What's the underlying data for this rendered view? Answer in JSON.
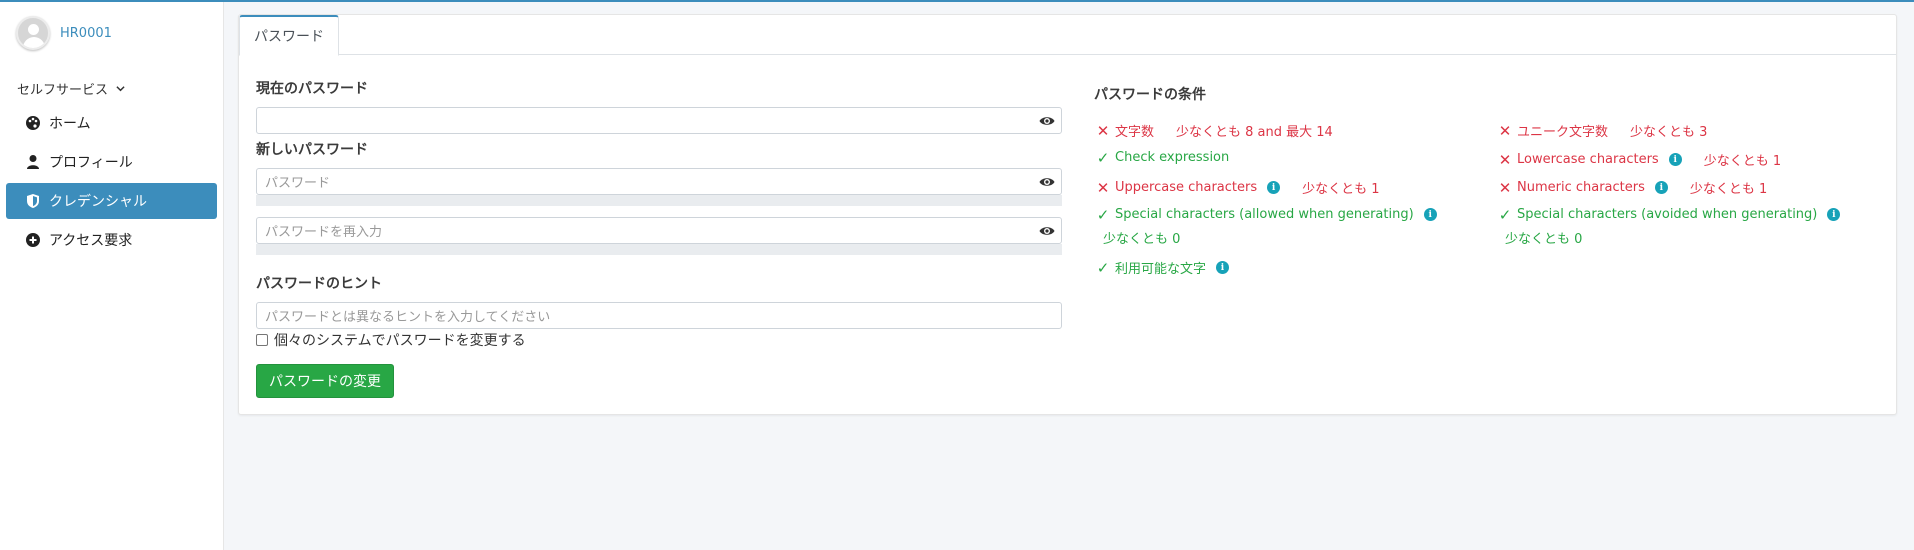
{
  "user": {
    "name": "HR0001"
  },
  "sidebar": {
    "section_title": "セルフサービス",
    "items": [
      {
        "label": "ホーム",
        "icon": "palette-icon"
      },
      {
        "label": "プロフィール",
        "icon": "person-icon"
      },
      {
        "label": "クレデンシャル",
        "icon": "shield-icon"
      },
      {
        "label": "アクセス要求",
        "icon": "plus-circle-icon"
      }
    ],
    "active_index": 2
  },
  "tabs": [
    {
      "label": "パスワード"
    }
  ],
  "form": {
    "current_label": "現在のパスワード",
    "current_value": "",
    "new_label": "新しいパスワード",
    "new_placeholder": "パスワード",
    "confirm_placeholder": "パスワードを再入力",
    "hint_label": "パスワードのヒント",
    "hint_placeholder": "パスワードとは異なるヒントを入力してください",
    "individual_checkbox_label": "個々のシステムでパスワードを変更する",
    "individual_checked": false,
    "submit_label": "パスワードの変更"
  },
  "conditions": {
    "title": "パスワードの条件",
    "items": [
      {
        "name": "文字数",
        "requirement": "少なくとも 8 and 最大 14",
        "status": "fail",
        "info": false
      },
      {
        "name": "ユニーク文字数",
        "requirement": "少なくとも 3",
        "status": "fail",
        "info": false
      },
      {
        "name": "Check expression",
        "requirement": "",
        "status": "ok",
        "info": false
      },
      {
        "name": "Lowercase characters",
        "requirement": "少なくとも 1",
        "status": "fail",
        "info": true
      },
      {
        "name": "Uppercase characters",
        "requirement": "少なくとも 1",
        "status": "fail",
        "info": true
      },
      {
        "name": "Numeric characters",
        "requirement": "少なくとも 1",
        "status": "fail",
        "info": true
      },
      {
        "name": "Special characters (allowed when generating)",
        "requirement": "少なくとも 0",
        "status": "ok",
        "info": true
      },
      {
        "name": "Special characters (avoided when generating)",
        "requirement": "少なくとも 0",
        "status": "ok",
        "info": true
      },
      {
        "name": "利用可能な文字",
        "requirement": "",
        "status": "ok",
        "info": true
      }
    ]
  },
  "colors": {
    "accent": "#3c8dbc",
    "success": "#28a745",
    "danger": "#dc3545",
    "info": "#17a2b8"
  }
}
